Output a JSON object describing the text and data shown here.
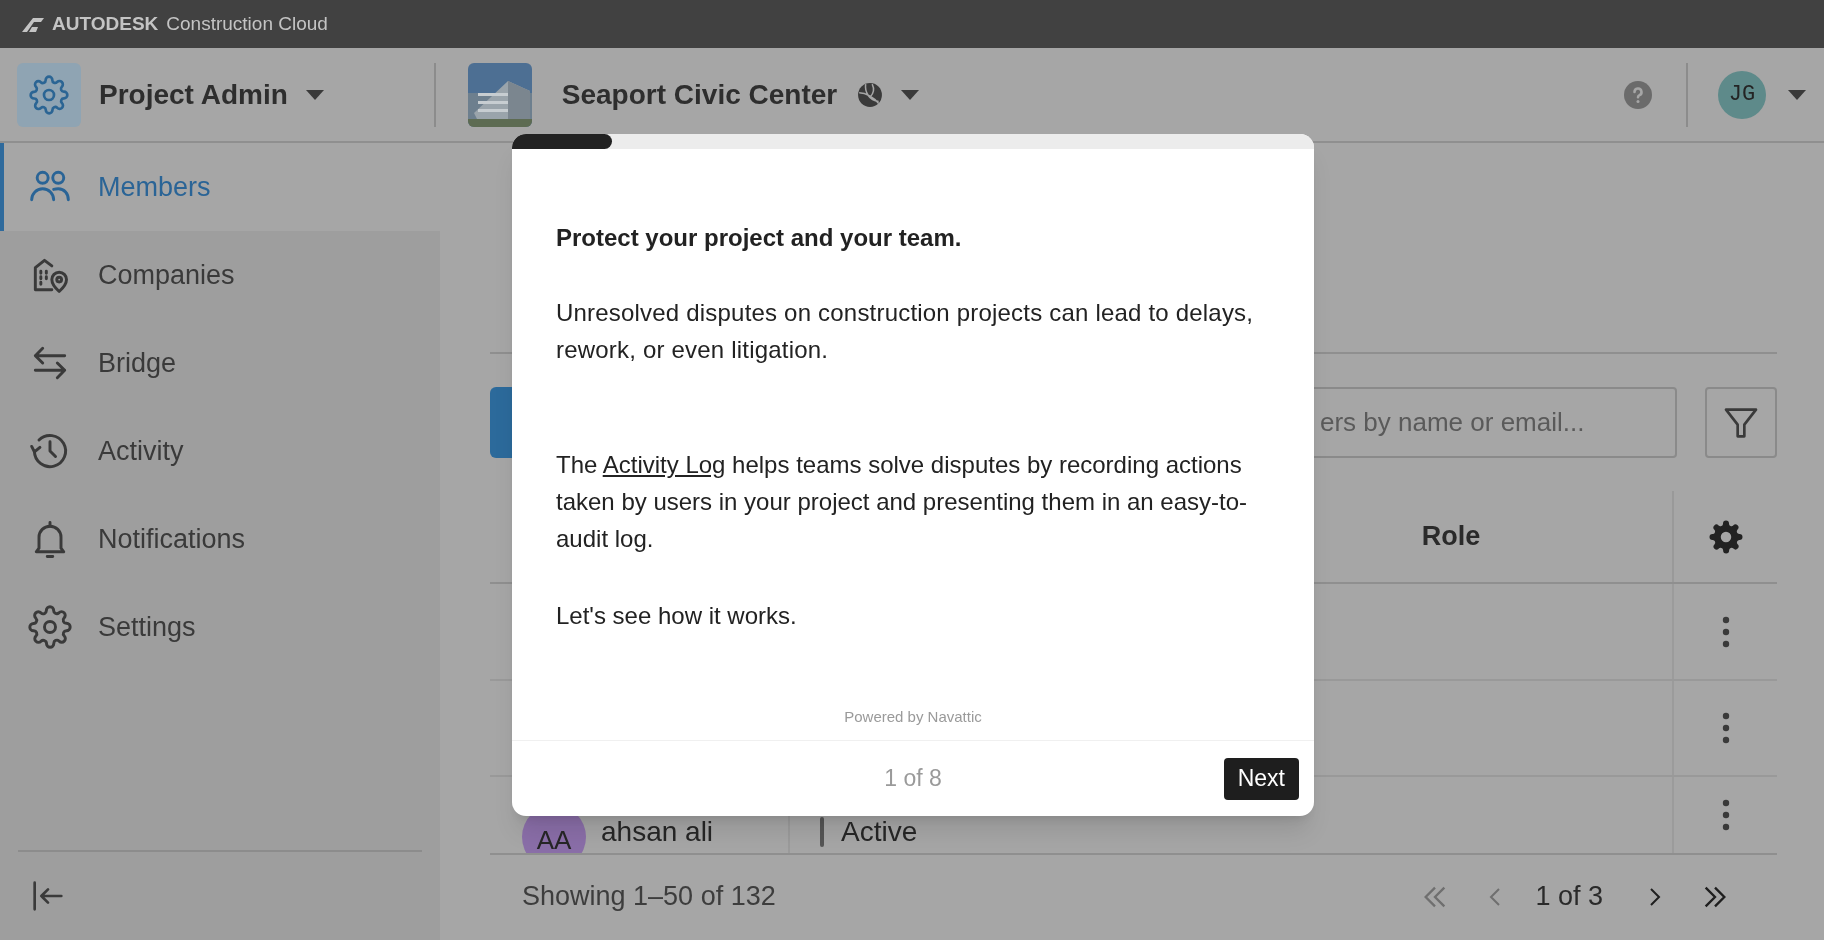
{
  "brand": {
    "name": "AUTODESK",
    "product": "Construction Cloud"
  },
  "module": {
    "title": "Project Admin"
  },
  "project": {
    "name": "Seaport Civic Center"
  },
  "user": {
    "initials": "JG"
  },
  "sidebar": {
    "items": [
      {
        "label": "Members",
        "kind": "people",
        "selected": true
      },
      {
        "label": "Companies",
        "kind": "building",
        "selected": false
      },
      {
        "label": "Bridge",
        "kind": "arrows",
        "selected": false
      },
      {
        "label": "Activity",
        "kind": "history",
        "selected": false
      },
      {
        "label": "Notifications",
        "kind": "bell",
        "selected": false
      },
      {
        "label": "Settings",
        "kind": "gear",
        "selected": false
      }
    ]
  },
  "search": {
    "placeholder": "ers by name or email..."
  },
  "table": {
    "columns": [
      {
        "label": "Role"
      }
    ],
    "rows": [
      {
        "kind": "hidden"
      },
      {
        "kind": "hidden"
      },
      {
        "kind": "member",
        "initials": "AA",
        "name": "ahsan ali",
        "status": "Active"
      }
    ]
  },
  "footer": {
    "summary": "Showing 1–50 of 132",
    "page": "1 of 3",
    "prev_disabled": true,
    "next_disabled": false
  },
  "tour": {
    "level": 0.125,
    "title": "Protect your project and your team.",
    "intro": "Unresolved disputes on construction projects can lead to delays, rework, or even litigation.",
    "body": {
      "before": "The ",
      "link": "Activity Log",
      "after": " helps teams solve disputes by recording actions taken by users in your project and presenting them in an easy-to-audit log."
    },
    "closing": "Let's see how it works.",
    "powered_by": "Powered by Navattic",
    "step": "1 of 8",
    "next": "Next"
  }
}
